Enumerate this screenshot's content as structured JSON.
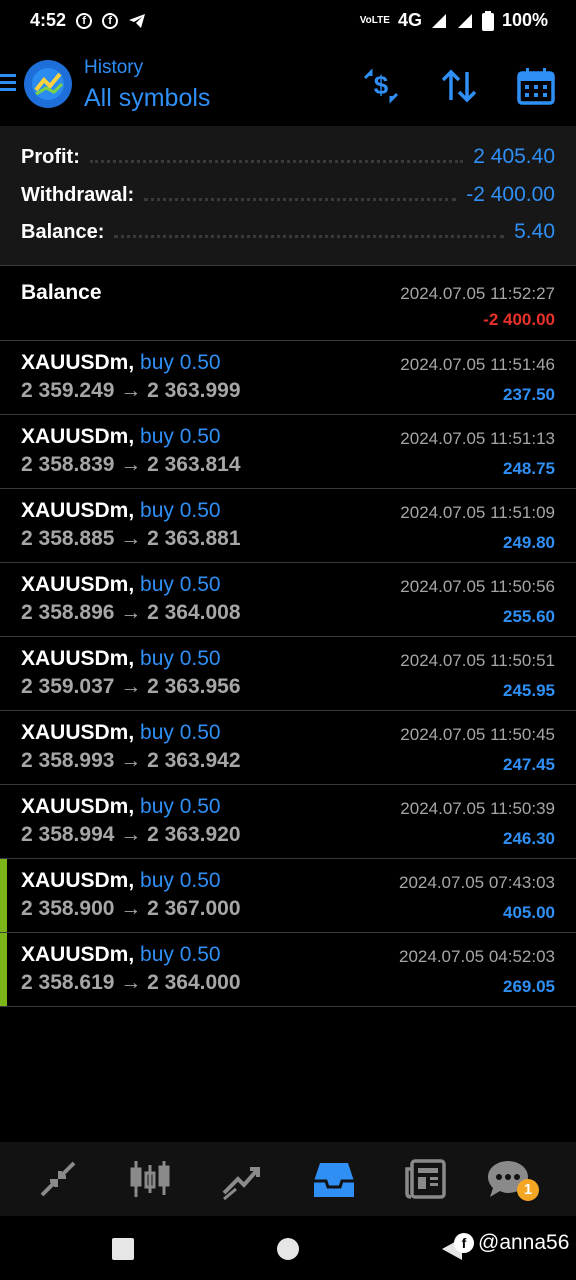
{
  "status_bar": {
    "time": "4:52",
    "network": "4G",
    "volte": "VoLTE",
    "battery": "100%"
  },
  "header": {
    "subtitle": "History",
    "title": "All symbols"
  },
  "summary": {
    "profit_label": "Profit:",
    "profit_value": "2 405.40",
    "withdrawal_label": "Withdrawal:",
    "withdrawal_value": "-2 400.00",
    "balance_label": "Balance:",
    "balance_value": "5.40"
  },
  "balance_entry": {
    "title": "Balance",
    "time": "2024.07.05 11:52:27",
    "value": "-2 400.00"
  },
  "deals": [
    {
      "symbol": "XAUUSDm,",
      "side": "buy 0.50",
      "prices": "2 359.249 → 2 363.999",
      "time": "2024.07.05 11:51:46",
      "profit": "237.50",
      "marked": false
    },
    {
      "symbol": "XAUUSDm,",
      "side": "buy 0.50",
      "prices": "2 358.839 → 2 363.814",
      "time": "2024.07.05 11:51:13",
      "profit": "248.75",
      "marked": false
    },
    {
      "symbol": "XAUUSDm,",
      "side": "buy 0.50",
      "prices": "2 358.885 → 2 363.881",
      "time": "2024.07.05 11:51:09",
      "profit": "249.80",
      "marked": false
    },
    {
      "symbol": "XAUUSDm,",
      "side": "buy 0.50",
      "prices": "2 358.896 → 2 364.008",
      "time": "2024.07.05 11:50:56",
      "profit": "255.60",
      "marked": false
    },
    {
      "symbol": "XAUUSDm,",
      "side": "buy 0.50",
      "prices": "2 359.037 → 2 363.956",
      "time": "2024.07.05 11:50:51",
      "profit": "245.95",
      "marked": false
    },
    {
      "symbol": "XAUUSDm,",
      "side": "buy 0.50",
      "prices": "2 358.993 → 2 363.942",
      "time": "2024.07.05 11:50:45",
      "profit": "247.45",
      "marked": false
    },
    {
      "symbol": "XAUUSDm,",
      "side": "buy 0.50",
      "prices": "2 358.994 → 2 363.920",
      "time": "2024.07.05 11:50:39",
      "profit": "246.30",
      "marked": false
    },
    {
      "symbol": "XAUUSDm,",
      "side": "buy 0.50",
      "prices": "2 358.900 → 2 367.000",
      "time": "2024.07.05 07:43:03",
      "profit": "405.00",
      "marked": true
    },
    {
      "symbol": "XAUUSDm,",
      "side": "buy 0.50",
      "prices": "2 358.619 → 2 364.000",
      "time": "2024.07.05 04:52:03",
      "profit": "269.05",
      "marked": true
    }
  ],
  "tabbar": {
    "items": [
      "quotes-icon",
      "chart-icon",
      "trade-icon",
      "history-icon",
      "news-icon",
      "chat-icon"
    ],
    "active": "history-icon",
    "chat_badge": "1"
  },
  "watermark": {
    "text": "@anna56"
  },
  "colors": {
    "accent_blue": "#2f8ff4",
    "negative_red": "#e8312a",
    "marker_green": "#7cb518"
  }
}
